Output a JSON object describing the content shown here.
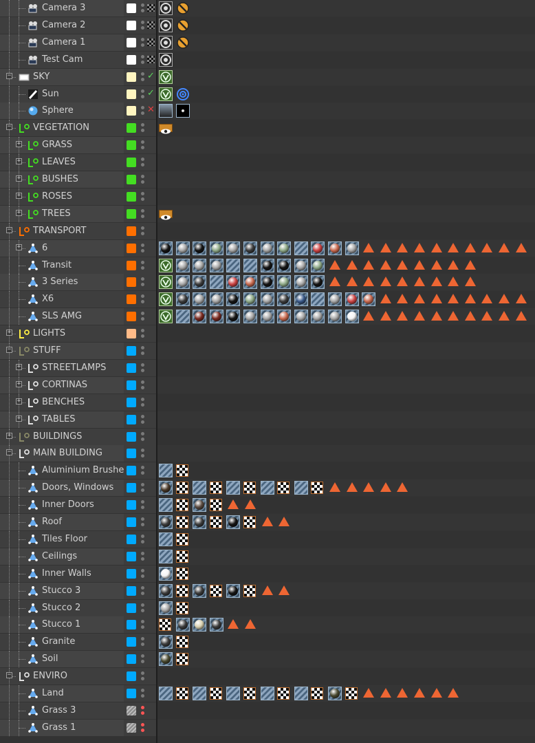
{
  "panel": {
    "name_col_color": "#444444",
    "tag_col_color": "#353535",
    "accent_triangle": "#ee6633"
  },
  "rows": [
    {
      "label": "Camera 3",
      "depth": 1,
      "icon": "camera-icon",
      "expander": "none",
      "color": "#ffffff",
      "flag": "none",
      "tags": [
        "camera-tag",
        "protection-tag"
      ]
    },
    {
      "label": "Camera 2",
      "depth": 1,
      "icon": "camera-icon",
      "expander": "none",
      "color": "#ffffff",
      "flag": "none",
      "tags": [
        "camera-tag",
        "protection-tag"
      ]
    },
    {
      "label": "Camera 1",
      "depth": 1,
      "icon": "camera-icon",
      "expander": "none",
      "color": "#ffffff",
      "flag": "none",
      "tags": [
        "camera-tag",
        "protection-tag"
      ]
    },
    {
      "label": "Test Cam",
      "depth": 1,
      "icon": "camera-icon",
      "expander": "none",
      "color": "#ffffff",
      "flag": "none",
      "tags": [
        "camera-tag"
      ]
    },
    {
      "label": "SKY",
      "depth": 0,
      "icon": "sky-icon",
      "expander": "minus",
      "color": "#fff5c0",
      "flag": "check",
      "tags": [
        "vray-tag"
      ]
    },
    {
      "label": "Sun",
      "depth": 1,
      "icon": "sun-light-icon",
      "expander": "none",
      "color": "#fff5c0",
      "flag": "check",
      "tags": [
        "vray-tag",
        "target-tag"
      ]
    },
    {
      "label": "Sphere",
      "depth": 1,
      "icon": "sphere-icon",
      "expander": "none",
      "color": "#fff5c0",
      "flag": "x",
      "tags": [
        "sky-material",
        "star-material"
      ]
    },
    {
      "label": "VEGETATION",
      "depth": 0,
      "icon": "layer-icon-green",
      "expander": "minus",
      "color": "#44dd22",
      "flag": "none",
      "tags": [
        "display-tag"
      ]
    },
    {
      "label": "GRASS",
      "depth": 1,
      "icon": "layer-icon-green",
      "expander": "plus",
      "color": "#44dd22",
      "flag": "none",
      "tags": []
    },
    {
      "label": "LEAVES",
      "depth": 1,
      "icon": "layer-icon-green",
      "expander": "plus",
      "color": "#44dd22",
      "flag": "none",
      "tags": []
    },
    {
      "label": "BUSHES",
      "depth": 1,
      "icon": "layer-icon-green",
      "expander": "plus",
      "color": "#44dd22",
      "flag": "none",
      "tags": []
    },
    {
      "label": "ROSES",
      "depth": 1,
      "icon": "layer-icon-green",
      "expander": "plus",
      "color": "#44dd22",
      "flag": "none",
      "tags": []
    },
    {
      "label": "TREES",
      "depth": 1,
      "icon": "layer-icon-green",
      "expander": "plus",
      "color": "#44dd22",
      "flag": "none",
      "tags": [
        "display-tag"
      ]
    },
    {
      "label": "TRANSPORT",
      "depth": 0,
      "icon": "layer-icon-orange",
      "expander": "minus",
      "color": "#ff6f00",
      "flag": "none",
      "tags": []
    },
    {
      "label": "6",
      "depth": 1,
      "icon": "polygon-object-icon",
      "expander": "plus",
      "color": "#ff6f00",
      "flag": "none",
      "tags": [
        "mat-black",
        "mat-grey",
        "mat-black",
        "mat-green",
        "mat-grey",
        "mat-dark",
        "mat-grey",
        "mat-green",
        "mat-stripe",
        "mat-red",
        "mat-orange",
        "mat-grey",
        "tri",
        "tri",
        "tri",
        "tri",
        "tri",
        "tri",
        "tri",
        "tri",
        "tri",
        "tri"
      ]
    },
    {
      "label": "Transit",
      "depth": 1,
      "icon": "polygon-object-icon",
      "expander": "none",
      "color": "#ff6f00",
      "flag": "none",
      "tags": [
        "vray-tag",
        "mat-grey",
        "mat-grey",
        "mat-grey",
        "mat-stripe",
        "mat-stripe",
        "mat-black",
        "mat-black",
        "mat-grey",
        "mat-green",
        "tri",
        "tri",
        "tri",
        "tri",
        "tri",
        "tri",
        "tri",
        "tri",
        "tri"
      ]
    },
    {
      "label": "3 Series",
      "depth": 1,
      "icon": "polygon-object-icon",
      "expander": "none",
      "color": "#ff6f00",
      "flag": "none",
      "tags": [
        "vray-tag",
        "mat-grey",
        "mat-dark",
        "mat-stripe",
        "mat-red",
        "mat-orange",
        "mat-black",
        "mat-green",
        "mat-grey",
        "mat-black",
        "tri",
        "tri",
        "tri",
        "tri",
        "tri",
        "tri",
        "tri",
        "tri",
        "tri"
      ]
    },
    {
      "label": "X6",
      "depth": 1,
      "icon": "polygon-object-icon",
      "expander": "none",
      "color": "#ff6f00",
      "flag": "none",
      "tags": [
        "vray-tag",
        "mat-dark",
        "mat-grey",
        "mat-grey",
        "mat-black",
        "mat-green",
        "mat-grey",
        "mat-dark",
        "mat-blue",
        "mat-stripe",
        "mat-grey",
        "mat-red",
        "mat-orange",
        "tri",
        "tri",
        "tri",
        "tri",
        "tri",
        "tri",
        "tri",
        "tri",
        "tri"
      ]
    },
    {
      "label": "SLS AMG",
      "depth": 1,
      "icon": "polygon-object-icon",
      "expander": "none",
      "color": "#ff6f00",
      "flag": "none",
      "tags": [
        "vray-tag",
        "mat-stripe",
        "mat-darkred",
        "mat-darkred",
        "mat-black",
        "mat-grey",
        "mat-grey",
        "mat-orange",
        "mat-grey",
        "mat-grey",
        "mat-grey",
        "mat-white",
        "tri",
        "tri",
        "tri",
        "tri",
        "tri",
        "tri",
        "tri",
        "tri",
        "tri",
        "tri"
      ]
    },
    {
      "label": "LIGHTS",
      "depth": 0,
      "icon": "layer-icon-yellow",
      "expander": "plus",
      "color": "#ffbb88",
      "flag": "none",
      "tags": []
    },
    {
      "label": "STUFF",
      "depth": 0,
      "icon": "layer-icon-dark",
      "expander": "minus",
      "color": "#00aaff",
      "flag": "none",
      "tags": []
    },
    {
      "label": "STREETLAMPS",
      "depth": 1,
      "icon": "layer-icon-white",
      "expander": "plus",
      "color": "#00aaff",
      "flag": "none",
      "tags": []
    },
    {
      "label": "CORTINAS",
      "depth": 1,
      "icon": "layer-icon-white",
      "expander": "plus",
      "color": "#00aaff",
      "flag": "none",
      "tags": []
    },
    {
      "label": "BENCHES",
      "depth": 1,
      "icon": "layer-icon-white",
      "expander": "plus",
      "color": "#00aaff",
      "flag": "none",
      "tags": []
    },
    {
      "label": "TABLES",
      "depth": 1,
      "icon": "layer-icon-white",
      "expander": "plus",
      "color": "#00aaff",
      "flag": "none",
      "tags": []
    },
    {
      "label": "BUILDINGS",
      "depth": 0,
      "icon": "layer-icon-dark",
      "expander": "plus",
      "color": "#00aaff",
      "flag": "none",
      "tags": []
    },
    {
      "label": "MAIN BUILDING",
      "depth": 0,
      "icon": "layer-icon-white",
      "expander": "minus",
      "color": "#00aaff",
      "flag": "none",
      "tags": []
    },
    {
      "label": "Aluminium Brushed",
      "depth": 1,
      "icon": "polygon-object-icon",
      "expander": "none",
      "color": "#00aaff",
      "flag": "none",
      "tags": [
        "mat-stripe",
        "checker-tag"
      ]
    },
    {
      "label": "Doors, Windows",
      "depth": 1,
      "icon": "polygon-object-icon",
      "expander": "none",
      "color": "#00aaff",
      "flag": "none",
      "tags": [
        "mat-wood",
        "checker-tag",
        "mat-stripe",
        "checker-tag",
        "mat-stripe",
        "checker-tag",
        "mat-stripe",
        "checker-tag",
        "mat-stripe",
        "checker-tag",
        "tri",
        "tri",
        "tri",
        "tri",
        "tri"
      ]
    },
    {
      "label": "Inner Doors",
      "depth": 1,
      "icon": "polygon-object-icon",
      "expander": "none",
      "color": "#00aaff",
      "flag": "none",
      "tags": [
        "mat-stripe",
        "checker-tag",
        "mat-brown",
        "checker-tag",
        "tri",
        "tri"
      ]
    },
    {
      "label": "Roof",
      "depth": 1,
      "icon": "polygon-object-icon",
      "expander": "none",
      "color": "#00aaff",
      "flag": "none",
      "tags": [
        "mat-dark",
        "checker-tag",
        "mat-dark",
        "checker-tag",
        "mat-black",
        "checker-tag",
        "tri",
        "tri"
      ]
    },
    {
      "label": "Tiles Floor",
      "depth": 1,
      "icon": "polygon-object-icon",
      "expander": "none",
      "color": "#00aaff",
      "flag": "none",
      "tags": [
        "mat-stripe",
        "checker-tag"
      ]
    },
    {
      "label": "Ceilings",
      "depth": 1,
      "icon": "polygon-object-icon",
      "expander": "none",
      "color": "#00aaff",
      "flag": "none",
      "tags": [
        "mat-stripe",
        "checker-tag"
      ]
    },
    {
      "label": "Inner Walls",
      "depth": 1,
      "icon": "polygon-object-icon",
      "expander": "none",
      "color": "#00aaff",
      "flag": "none",
      "tags": [
        "mat-white",
        "checker-tag"
      ]
    },
    {
      "label": "Stucco 3",
      "depth": 1,
      "icon": "polygon-object-icon",
      "expander": "none",
      "color": "#00aaff",
      "flag": "none",
      "tags": [
        "mat-dark",
        "checker-tag",
        "mat-dark",
        "checker-tag",
        "mat-black",
        "checker-tag",
        "tri",
        "tri"
      ]
    },
    {
      "label": "Stucco 2",
      "depth": 1,
      "icon": "polygon-object-icon",
      "expander": "none",
      "color": "#00aaff",
      "flag": "none",
      "tags": [
        "mat-grey",
        "checker-tag"
      ]
    },
    {
      "label": "Stucco 1",
      "depth": 1,
      "icon": "polygon-object-icon",
      "expander": "none",
      "color": "#00aaff",
      "flag": "none",
      "tags": [
        "checker-tag",
        "mat-dark",
        "mat-beige",
        "mat-dark",
        "tri",
        "tri"
      ]
    },
    {
      "label": "Granite",
      "depth": 1,
      "icon": "polygon-object-icon",
      "expander": "none",
      "color": "#00aaff",
      "flag": "none",
      "tags": [
        "mat-dark",
        "checker-tag"
      ]
    },
    {
      "label": "Soil",
      "depth": 1,
      "icon": "polygon-object-icon",
      "expander": "none",
      "color": "#00aaff",
      "flag": "none",
      "tags": [
        "mat-soil",
        "checker-tag"
      ]
    },
    {
      "label": "ENVIRO",
      "depth": 0,
      "icon": "layer-icon-white",
      "expander": "minus",
      "color": "#00aaff",
      "flag": "none",
      "tags": []
    },
    {
      "label": "Land",
      "depth": 1,
      "icon": "polygon-object-icon",
      "expander": "none",
      "color": "#00aaff",
      "flag": "none",
      "tags": [
        "mat-stripe",
        "checker-tag",
        "mat-stripe",
        "checker-tag",
        "mat-stripe",
        "checker-tag",
        "mat-stripe",
        "checker-tag",
        "mat-stripe",
        "checker-tag",
        "mat-soil",
        "checker-tag",
        "tri",
        "tri",
        "tri",
        "tri",
        "tri",
        "tri"
      ]
    },
    {
      "label": "Grass 3",
      "depth": 1,
      "icon": "polygon-object-icon",
      "expander": "none",
      "color": "none",
      "flag": "none",
      "tags": []
    },
    {
      "label": "Grass 1",
      "depth": 1,
      "icon": "polygon-object-icon",
      "expander": "none",
      "color": "none",
      "flag": "none",
      "tags": []
    }
  ]
}
